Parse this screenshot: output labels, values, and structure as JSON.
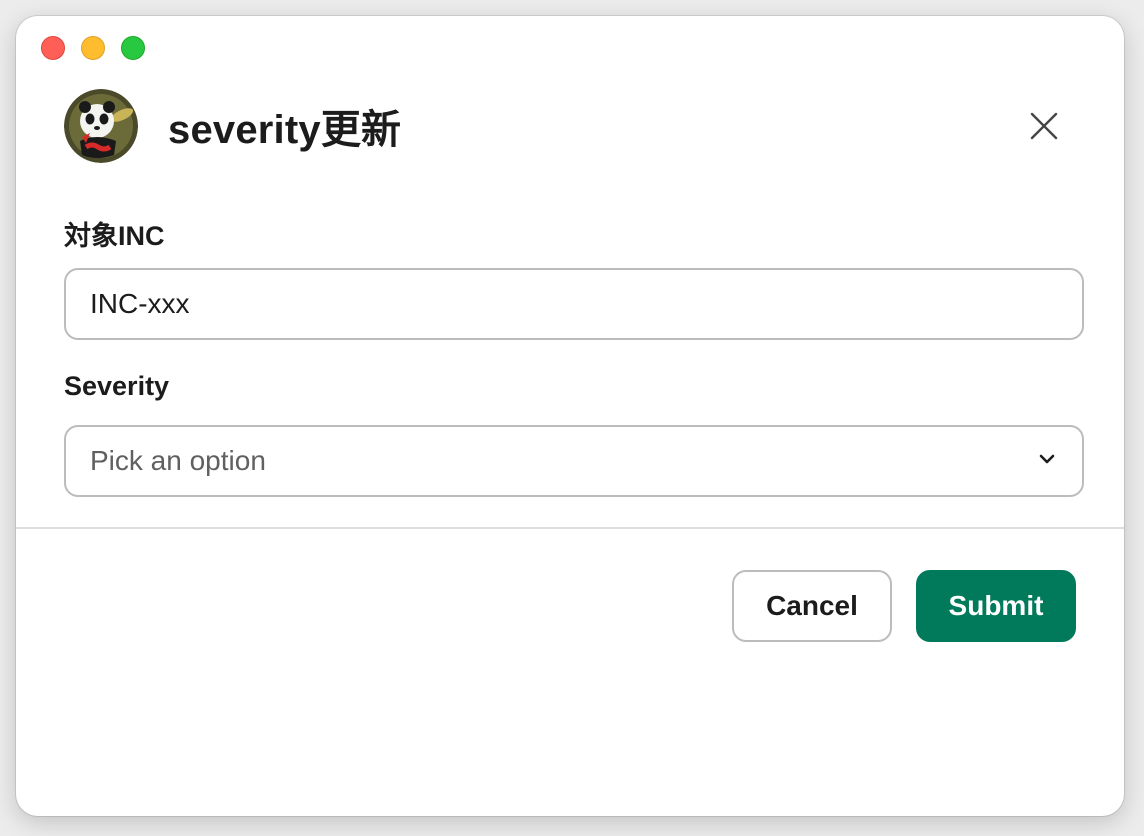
{
  "window": {
    "controls": [
      "close",
      "minimize",
      "zoom"
    ]
  },
  "header": {
    "title": "severity更新",
    "avatar_icon": "panda-logo-icon",
    "close_icon": "close-icon"
  },
  "form": {
    "inc_field": {
      "label": "対象INC",
      "value": "INC-xxx"
    },
    "severity_field": {
      "label": "Severity",
      "placeholder": "Pick an option",
      "icon": "chevron-down-icon"
    }
  },
  "footer": {
    "cancel_label": "Cancel",
    "submit_label": "Submit"
  },
  "colors": {
    "submit_bg": "#007a5a",
    "border": "#bdbcbd",
    "text": "#1d1c1d"
  }
}
